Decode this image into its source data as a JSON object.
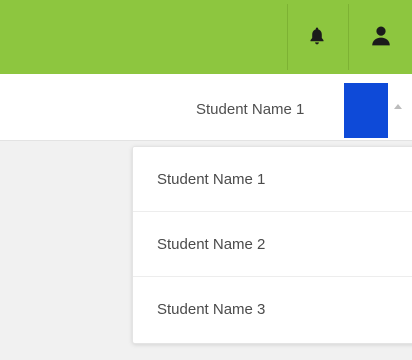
{
  "topbar": {
    "notification_icon": "bell-icon",
    "user_icon": "user-icon",
    "accent_color": "#8dc63f"
  },
  "student_select": {
    "selected_value": "Student Name 1",
    "marker_color": "#0e4ad8",
    "caret_icon": "chevron-up-icon"
  },
  "dropdown": {
    "options": [
      {
        "label": "Student Name 1"
      },
      {
        "label": "Student Name 2"
      },
      {
        "label": "Student Name 3"
      }
    ]
  }
}
